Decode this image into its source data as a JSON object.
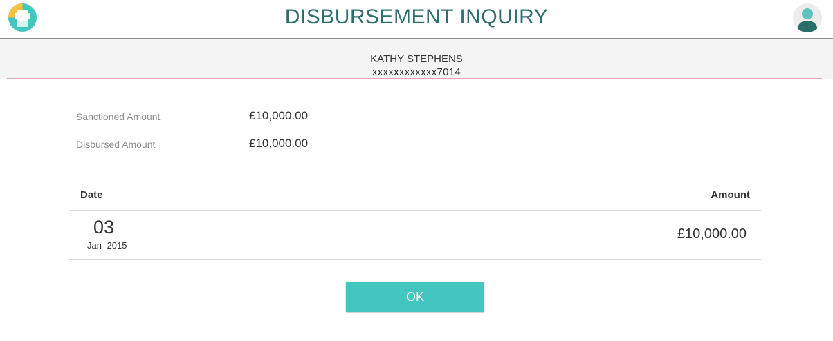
{
  "header": {
    "title": "DISBURSEMENT INQUIRY",
    "logo_icon": "bank-logo-icon",
    "avatar_icon": "user-avatar-icon"
  },
  "customer": {
    "name": "KATHY STEPHENS",
    "account": "xxxxxxxxxxxx7014"
  },
  "summary": {
    "sanctioned_label": "Sanctioned Amount",
    "sanctioned_value": "£10,000.00",
    "disbursed_label": "Disbursed Amount",
    "disbursed_value": "£10,000.00"
  },
  "table": {
    "headers": {
      "date": "Date",
      "amount": "Amount"
    },
    "rows": [
      {
        "day": "03",
        "month_year": "Jan 2015",
        "amount": "£10,000.00"
      }
    ]
  },
  "actions": {
    "ok_label": "OK"
  },
  "colors": {
    "brand_teal": "#43c6bf",
    "title_teal": "#2f6f6b",
    "banner_bg": "#f4f4f4",
    "accent_line": "#e6a6b8"
  }
}
